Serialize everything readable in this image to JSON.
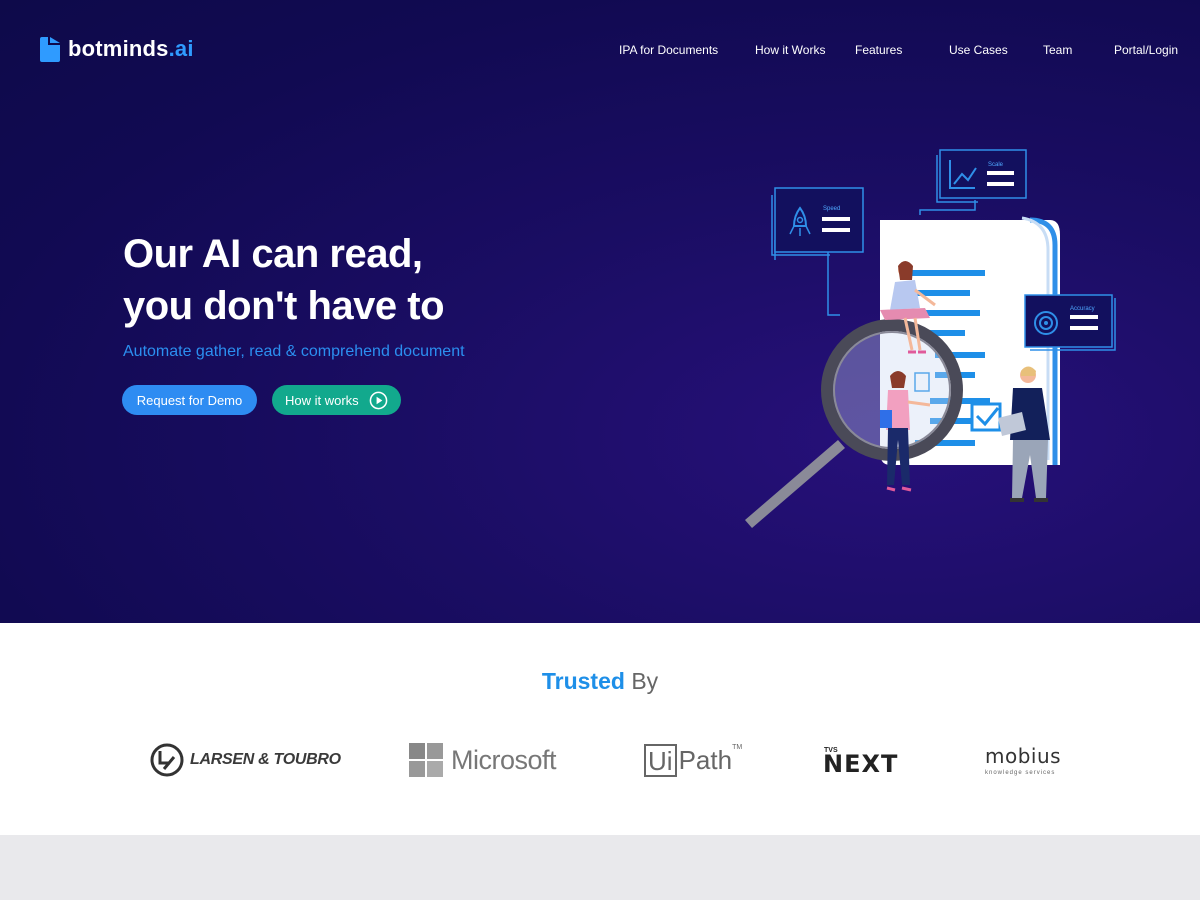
{
  "brand": {
    "name": "botminds",
    "tld": ".ai",
    "accent": "#2f9bff"
  },
  "nav": {
    "items": [
      {
        "label": "IPA for Documents"
      },
      {
        "label": "How it Works"
      },
      {
        "label": "Features"
      },
      {
        "label": "Use Cases"
      },
      {
        "label": "Team"
      },
      {
        "label": "Portal/Login"
      }
    ]
  },
  "hero": {
    "headline_line1": "Our AI can read,",
    "headline_line2": "you don't have to",
    "subline": "Automate gather, read & comprehend document",
    "cta_demo": "Request for Demo",
    "cta_how": "How it works",
    "illustration": {
      "card_speed": "Speed",
      "card_scale": "Scale",
      "card_accuracy": "Accuracy"
    }
  },
  "trusted": {
    "title_strong": "Trusted",
    "title_light": "By",
    "logos": {
      "lt": "LARSEN & TOUBRO",
      "microsoft": "Microsoft",
      "uipath_box": "Ui",
      "uipath_rest": "Path",
      "uipath_tm": "TM",
      "tvs": "TVS",
      "next": "NEXT",
      "mobius": "mobius",
      "mobius_sub": "knowledge services"
    }
  },
  "colors": {
    "hero_bg": "#120b55",
    "cta_demo": "#2e8cf2",
    "cta_how": "#12a98d",
    "trusted_accent": "#1e8fe8"
  }
}
